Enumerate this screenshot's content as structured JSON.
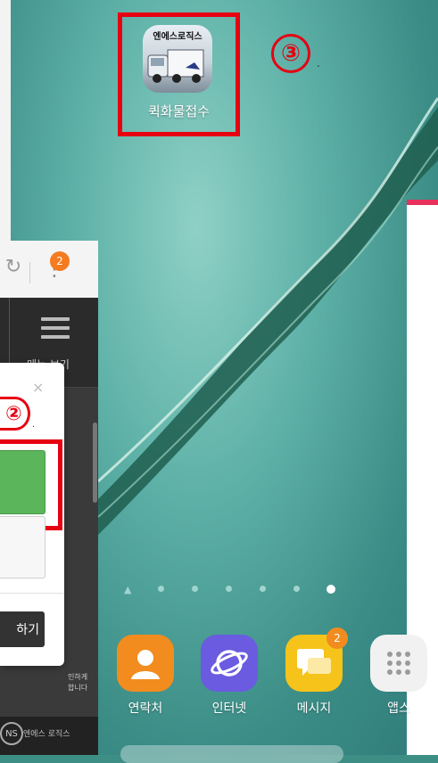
{
  "home": {
    "app": {
      "label": "퀵화물접수",
      "brand_text": "엔에스로직스"
    },
    "step3_label": "③",
    "step3_dot": "."
  },
  "browser": {
    "refresh_icon": "↻",
    "more_icon": "⋮",
    "badge_count": "2",
    "menu_label": "메뉴 보기",
    "bottom_text_line1": "인하게",
    "bottom_text_line2": "합니다",
    "logo_circle_text": "NS",
    "logo_name": "엔에스 로직스"
  },
  "dialog": {
    "close_icon": "×",
    "step2_label": "②",
    "step2_dot": ".",
    "do_button_label": "하기"
  },
  "dock": {
    "items": [
      {
        "label": "연락처",
        "icon": "contacts-icon"
      },
      {
        "label": "인터넷",
        "icon": "internet-icon"
      },
      {
        "label": "메시지",
        "icon": "messages-icon",
        "badge": "2"
      },
      {
        "label": "앱스",
        "icon": "apps-icon"
      }
    ]
  },
  "colors": {
    "highlight": "#e60012",
    "wallpaper": "#3d8f86",
    "badge": "#f47b20",
    "green_button": "#5bb55b"
  }
}
